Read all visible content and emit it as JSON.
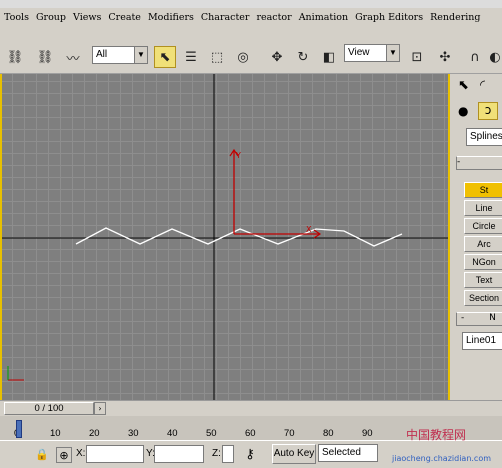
{
  "menu": [
    "Tools",
    "Group",
    "Views",
    "Create",
    "Modifiers",
    "Character",
    "reactor",
    "Animation",
    "Graph Editors",
    "Rendering"
  ],
  "toolbar": {
    "selection_filter": "All",
    "reference_coord": "View"
  },
  "command_panel": {
    "category_dropdown": "Splines",
    "object_types": [
      "St",
      "Line",
      "Circle",
      "Arc",
      "NGon",
      "Text",
      "Section"
    ],
    "rollout_name": "N",
    "object_name": "Line01"
  },
  "time_slider": {
    "label": "0 / 100"
  },
  "trackbar": {
    "ticks": [
      "0",
      "10",
      "20",
      "30",
      "40",
      "50",
      "60",
      "70",
      "80",
      "90"
    ]
  },
  "statusbar": {
    "x_label": "X:",
    "y_label": "Y:",
    "z_label": "Z:",
    "autokey_label": "Auto Key",
    "selected_label": "Selected"
  },
  "watermark": {
    "line1": "中国教程网",
    "line2": "jiaocheng.chazidian.com"
  },
  "colors": {
    "viewport_bg": "#7f7f7f",
    "active_border": "#e8c000",
    "spline": "#ffffff",
    "gizmo": "#c00000"
  }
}
